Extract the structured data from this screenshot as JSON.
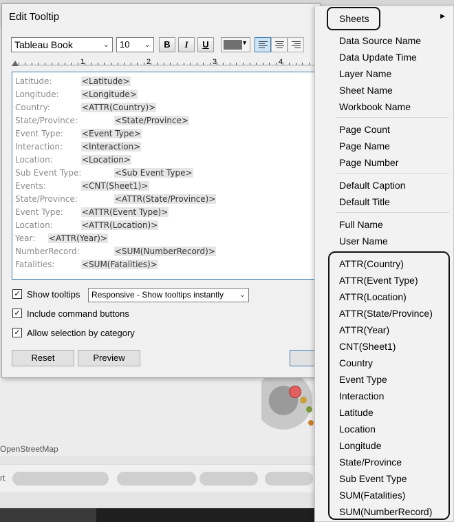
{
  "background": {
    "map_credit": "OpenStreetMap",
    "tab_sliver": "rt"
  },
  "dialog": {
    "title": "Edit Tooltip",
    "font_name": "Tableau Book",
    "font_size": "10",
    "bold_label": "B",
    "italic_label": "I",
    "underline_label": "U",
    "text_color": "#6f6f6f",
    "ruler_numbers": [
      "1",
      "2",
      "3",
      "4"
    ],
    "tooltip_rows": [
      {
        "label": "Latitude:",
        "field": "<Latitude>"
      },
      {
        "label": "Longitude:",
        "field": "<Longitude>"
      },
      {
        "label": "Country:",
        "field": "<ATTR(Country)>"
      },
      {
        "label": "State/Province:",
        "field": "<State/Province>"
      },
      {
        "label": "Event Type:",
        "field": "<Event Type>"
      },
      {
        "label": "Interaction:",
        "field": "<Interaction>"
      },
      {
        "label": "Location:",
        "field": "<Location>"
      },
      {
        "label": "Sub Event Type:",
        "field": "<Sub Event Type>"
      },
      {
        "label": "Events:",
        "field": "<CNT(Sheet1)>"
      },
      {
        "label": "State/Province:",
        "field": "<ATTR(State/Province)>"
      },
      {
        "label": "Event Type:",
        "field": "<ATTR(Event Type)>"
      },
      {
        "label": "Location:",
        "field": "<ATTR(Location)>"
      },
      {
        "label": "Year:",
        "field": "<ATTR(Year)>"
      },
      {
        "label": "NumberRecord:",
        "field": "<SUM(NumberRecord)>"
      },
      {
        "label": "Fatalities:",
        "field": "<SUM(Fatalities)>"
      }
    ],
    "show_tooltips_label": "Show tooltips",
    "show_tooltips_checked": true,
    "tooltip_mode": "Responsive - Show tooltips instantly",
    "include_command_buttons_label": "Include command buttons",
    "include_command_buttons_checked": true,
    "allow_selection_label": "Allow selection by category",
    "allow_selection_checked": true,
    "reset_label": "Reset",
    "preview_label": "Preview",
    "ok_label": ""
  },
  "insert_menu": {
    "sheets_label": "Sheets",
    "group_source": [
      "Data Source Name",
      "Data Update Time",
      "Layer Name",
      "Sheet Name",
      "Workbook Name"
    ],
    "group_page": [
      "Page Count",
      "Page Name",
      "Page Number"
    ],
    "group_caption": [
      "Default Caption",
      "Default Title"
    ],
    "group_user": [
      "Full Name",
      "User Name"
    ],
    "group_fields": [
      "ATTR(Country)",
      "ATTR(Event Type)",
      "ATTR(Location)",
      "ATTR(State/Province)",
      "ATTR(Year)",
      "CNT(Sheet1)",
      "Country",
      "Event Type",
      "Interaction",
      "Latitude",
      "Location",
      "Longitude",
      "State/Province",
      "Sub Event Type",
      "SUM(Fatalities)",
      "SUM(NumberRecord)"
    ]
  },
  "colors": {
    "accent_blue": "#3c7fb1",
    "field_highlight": "#e5e5e5",
    "annotation_ink": "#111111"
  }
}
